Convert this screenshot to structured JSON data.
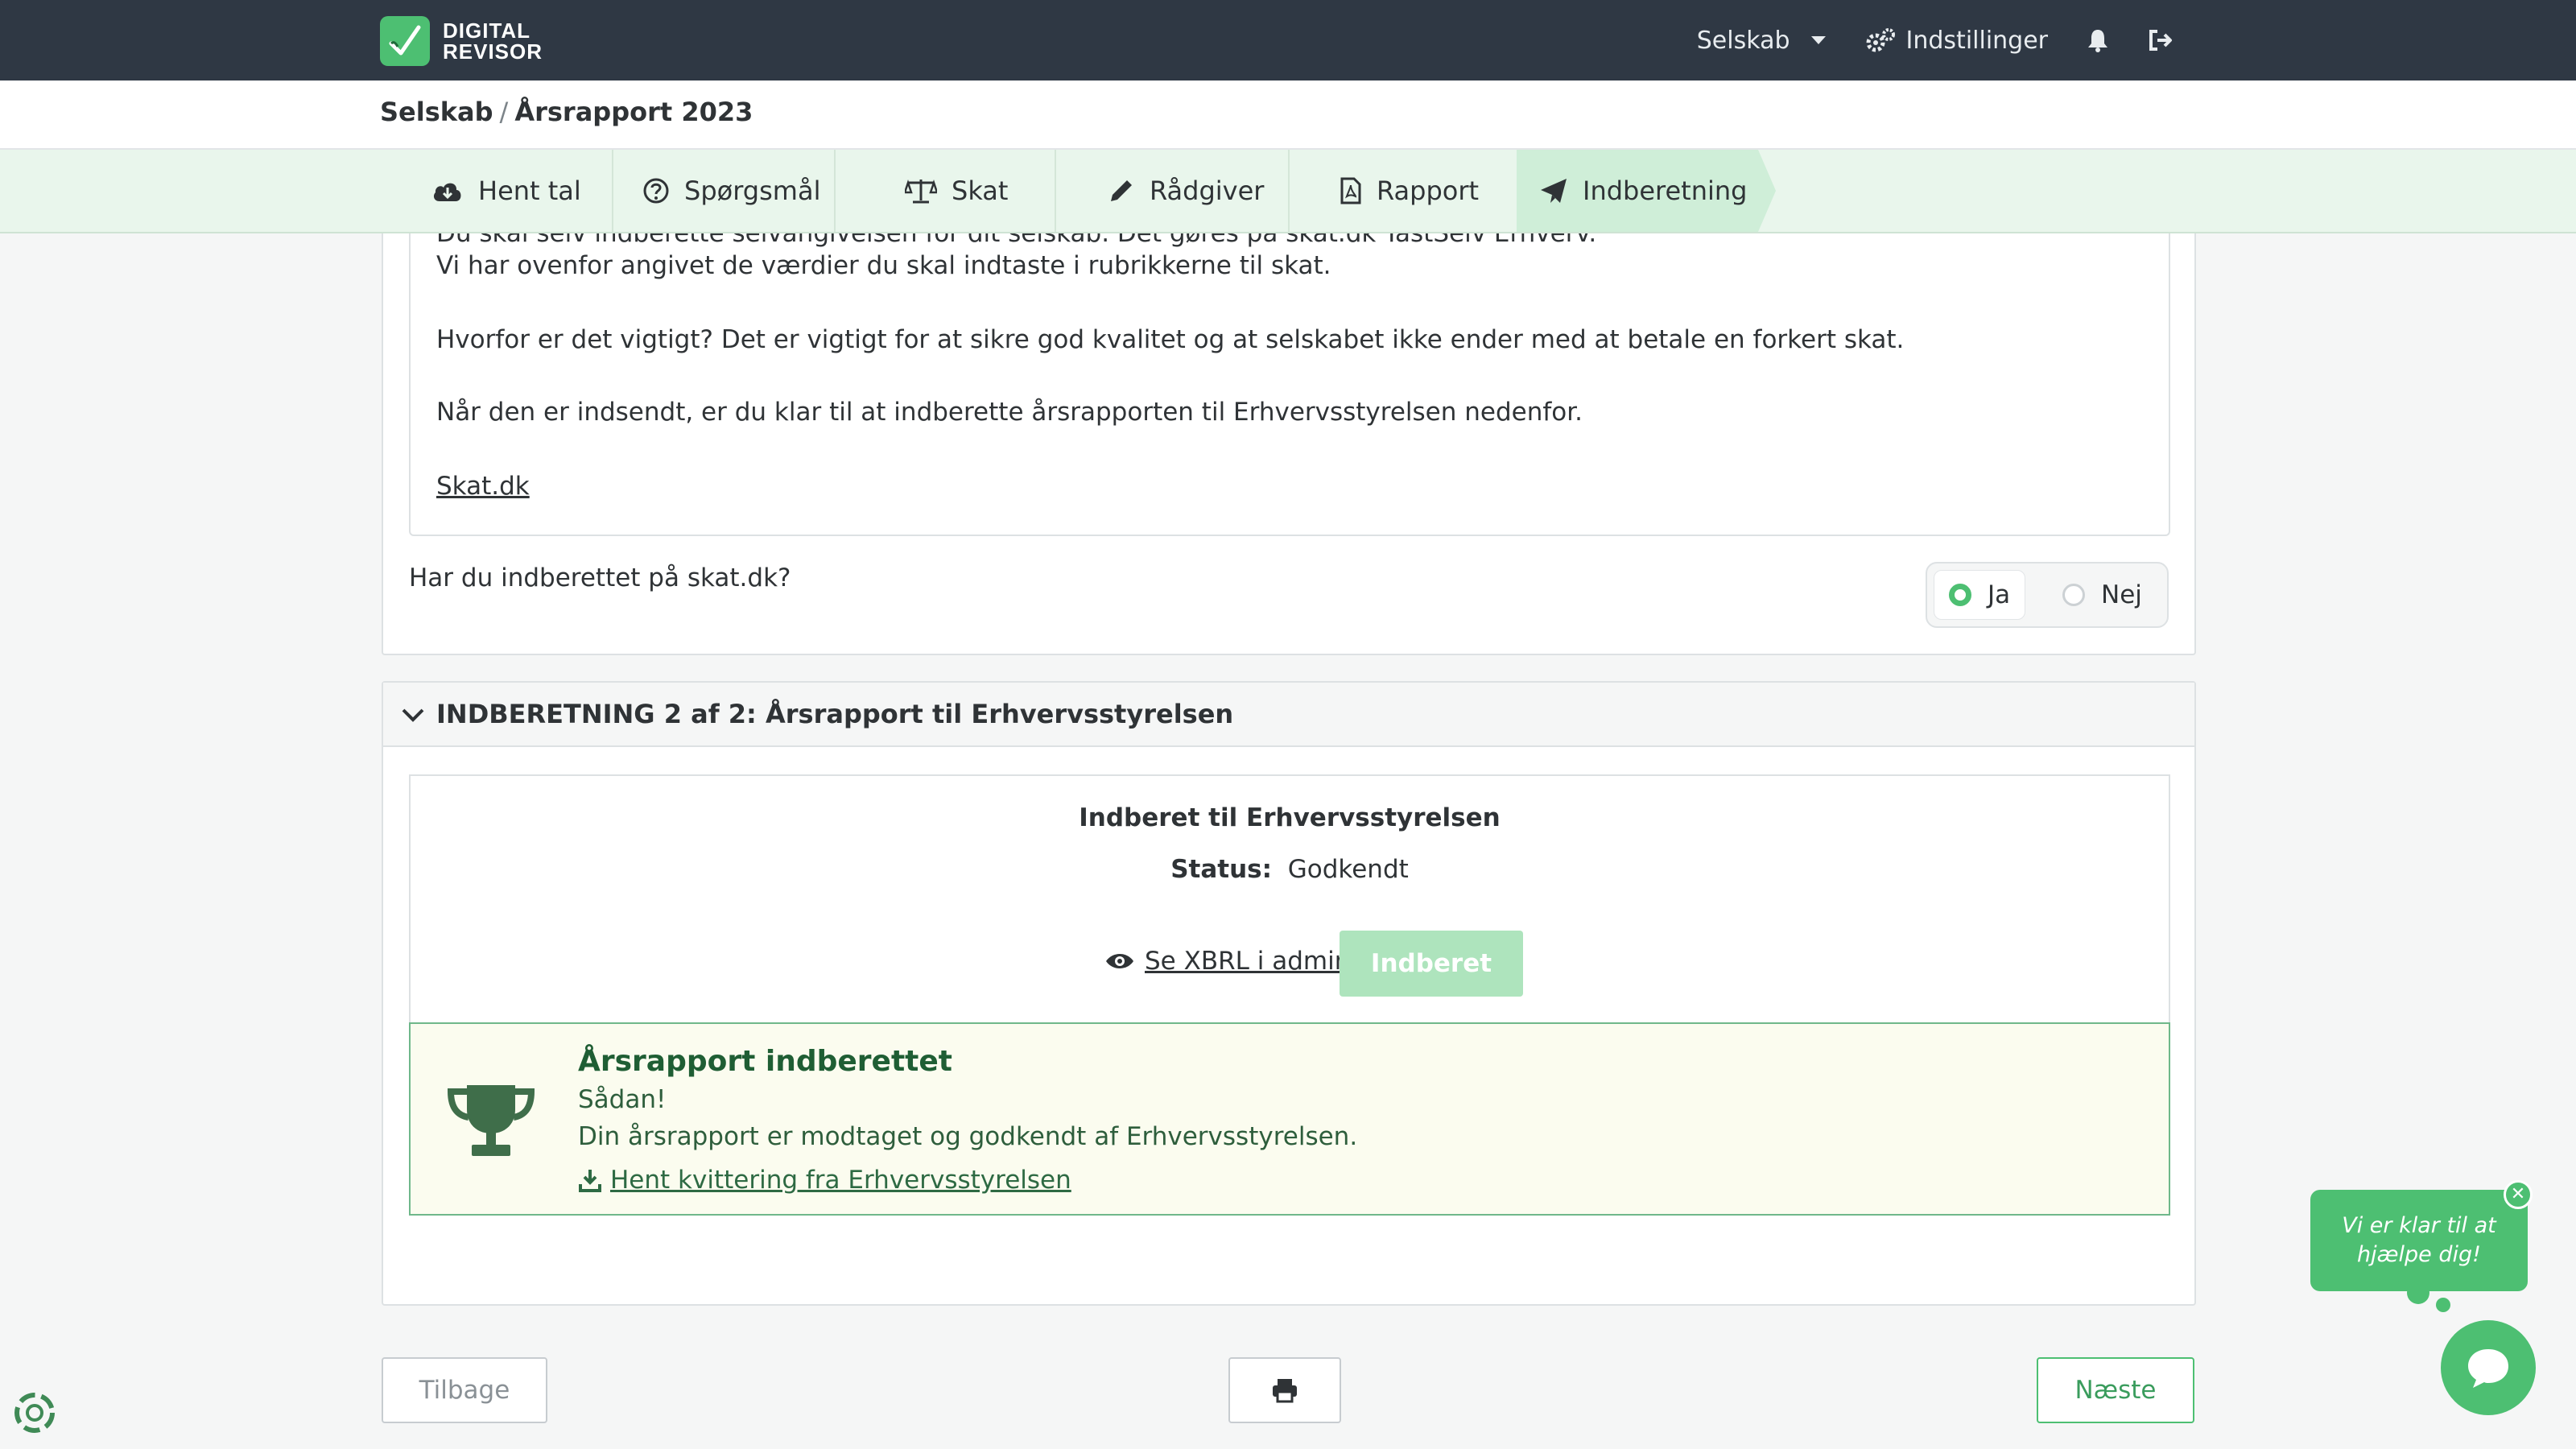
{
  "header": {
    "logo_line1": "DIGITAL",
    "logo_line2": "REVISOR",
    "company_menu": "Selskab",
    "settings": "Indstillinger"
  },
  "breadcrumb": {
    "parent": "Selskab",
    "separator": "/",
    "current": "Årsrapport 2023"
  },
  "tabs": [
    {
      "label": "Hent tal",
      "icon": "cloud-download-icon"
    },
    {
      "label": "Spørgsmål",
      "icon": "question-circle-icon"
    },
    {
      "label": "Skat",
      "icon": "balance-scale-icon"
    },
    {
      "label": "Rådgiver",
      "icon": "pencil-icon"
    },
    {
      "label": "Rapport",
      "icon": "file-pdf-icon"
    },
    {
      "label": "Indberetning",
      "icon": "paper-plane-icon",
      "active": true
    }
  ],
  "tax_section": {
    "cut_line": "Du skal selv indberette selvangivelsen for dit selskab. Det gøres på skat.dk TastSelv Erhverv.",
    "line2": "Vi har ovenfor angivet de værdier du skal indtaste i rubrikkerne til skat.",
    "line3": "Hvorfor er det vigtigt? Det er vigtigt for at sikre god kvalitet og at selskabet ikke ender med at betale en forkert skat.",
    "line4": "Når den er indsendt, er du klar til at indberette årsrapporten til Erhvervsstyrelsen nedenfor.",
    "link": "Skat.dk",
    "question": "Har du indberettet på skat.dk?",
    "option_yes": "Ja",
    "option_no": "Nej",
    "selected": "Ja"
  },
  "section2": {
    "title": "INDBERETNING 2 af 2: Årsrapport til Erhvervsstyrelsen",
    "status_title": "Indberet til Erhvervsstyrelsen",
    "status_label": "Status:",
    "status_value": "Godkendt",
    "xbrl_link": "Se XBRL i admin",
    "submit_button": "Indberet",
    "success_title": "Årsrapport indberettet",
    "success_line1": "Sådan!",
    "success_line2": "Din årsrapport er modtaget og godkendt af Erhvervsstyrelsen.",
    "receipt_link": "Hent kvittering fra Erhvervsstyrelsen"
  },
  "footer": {
    "back": "Tilbage",
    "next": "Næste"
  },
  "chat": {
    "bubble": "Vi er klar til at hjælpe dig!"
  },
  "colors": {
    "brand_green": "#4dbf72",
    "topbar": "#2f3844",
    "tabbar": "#e9f6ec",
    "success_border": "#6fb88a"
  }
}
